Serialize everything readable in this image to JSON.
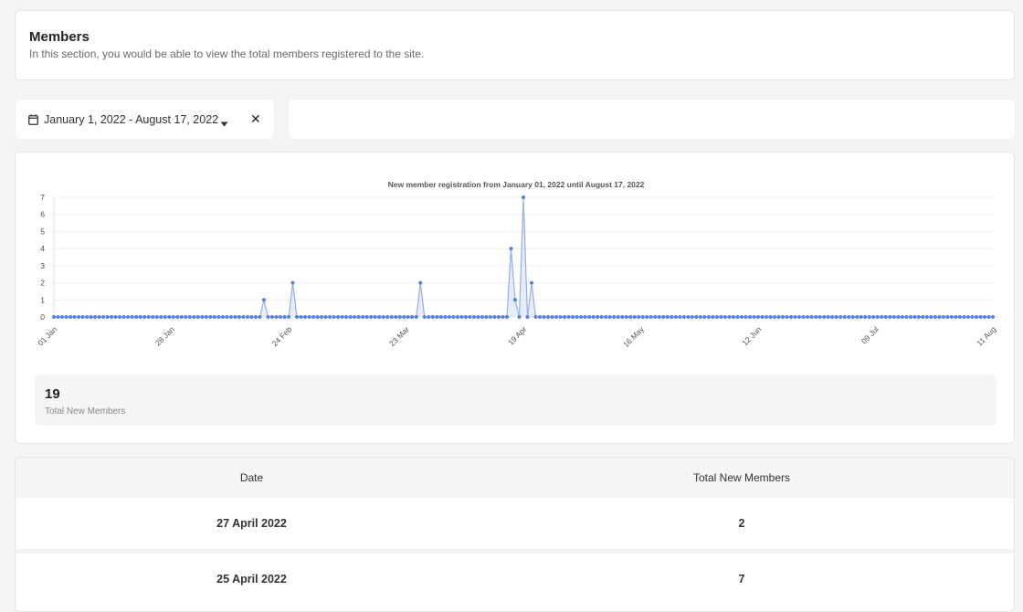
{
  "header": {
    "title": "Members",
    "description": "In this section, you would be able to view the total members registered to the site."
  },
  "date_filter": {
    "range_label": "January 1, 2022 - August 17, 2022",
    "clear_label": "✕",
    "calendar_icon": "calendar-icon",
    "caret_icon": "caret-down-icon"
  },
  "stats": {
    "total_value": "19",
    "total_label": "Total New Members"
  },
  "table": {
    "headers": [
      "Date",
      "Total New Members"
    ],
    "rows": [
      {
        "date": "27 April 2022",
        "total": "2"
      },
      {
        "date": "25 April 2022",
        "total": "7"
      }
    ]
  },
  "colors": {
    "line": "#5b7fd9",
    "area": "#c9d5f5",
    "grid": "#eeeeee"
  },
  "chart_data": {
    "type": "line",
    "title": "New member registration from January 01, 2022 until August 17, 2022",
    "xlabel": "",
    "ylabel": "",
    "ylim": [
      0,
      7
    ],
    "yticks": [
      0,
      1,
      2,
      3,
      4,
      5,
      6,
      7
    ],
    "x_ticks": [
      "01 Jan",
      "28 Jan",
      "24 Feb",
      "23 Mar",
      "19 Apr",
      "16 May",
      "12 Jun",
      "09 Jul",
      "11 Aug"
    ],
    "x_start": "2022-01-01",
    "x_end": "2022-08-17",
    "nonzero_points": [
      {
        "date": "2022-02-21",
        "value": 1
      },
      {
        "date": "2022-02-28",
        "value": 2
      },
      {
        "date": "2022-03-31",
        "value": 2
      },
      {
        "date": "2022-04-22",
        "value": 4
      },
      {
        "date": "2022-04-23",
        "value": 1
      },
      {
        "date": "2022-04-25",
        "value": 7
      },
      {
        "date": "2022-04-27",
        "value": 2
      }
    ],
    "grid": true,
    "legend": "none"
  }
}
